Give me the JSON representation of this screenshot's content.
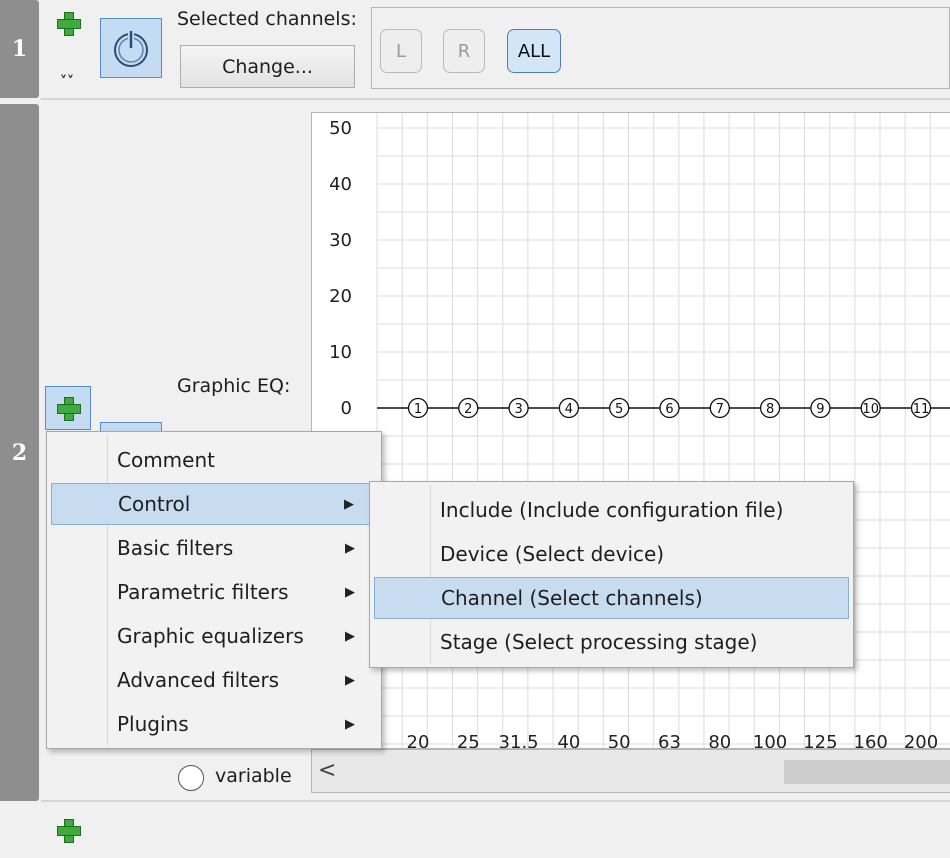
{
  "rows": [
    "1",
    "2"
  ],
  "row1": {
    "selected_channels_label": "Selected channels:",
    "change_button": "Change...",
    "channels": {
      "left": "L",
      "right": "R",
      "all": "ALL"
    }
  },
  "row2": {
    "graphic_eq_label": "Graphic EQ:",
    "variable_label": "variable",
    "scroll_left": "<"
  },
  "chart_data": {
    "type": "line",
    "y_ticks": [
      "50",
      "40",
      "30",
      "20",
      "10",
      "0"
    ],
    "ylim": [
      0,
      50
    ],
    "x_labels": [
      "20",
      "25",
      "31.5",
      "40",
      "50",
      "63",
      "80",
      "100",
      "125",
      "160",
      "200"
    ],
    "x": [
      20,
      25,
      31.5,
      40,
      50,
      63,
      80,
      100,
      125,
      160,
      200
    ],
    "values": [
      0,
      0,
      0,
      0,
      0,
      0,
      0,
      0,
      0,
      0,
      0
    ],
    "point_labels": [
      "1",
      "2",
      "3",
      "4",
      "5",
      "6",
      "7",
      "8",
      "9",
      "10",
      "11"
    ],
    "grid": true
  },
  "menu": {
    "items": [
      {
        "label": "Comment",
        "submenu": false
      },
      {
        "label": "Control",
        "submenu": true,
        "highlighted": true
      },
      {
        "label": "Basic filters",
        "submenu": true
      },
      {
        "label": "Parametric filters",
        "submenu": true
      },
      {
        "label": "Graphic equalizers",
        "submenu": true
      },
      {
        "label": "Advanced filters",
        "submenu": true
      },
      {
        "label": "Plugins",
        "submenu": true
      }
    ],
    "submenu": [
      {
        "label": "Include (Include configuration file)"
      },
      {
        "label": "Device (Select device)"
      },
      {
        "label": "Channel (Select channels)",
        "highlighted": true
      },
      {
        "label": "Stage (Select processing stage)"
      }
    ]
  },
  "icons": {
    "add": "plus-icon",
    "power": "power-icon",
    "collapse": "double-chevron-down-icon",
    "submenu_arrow": "triangle-right-icon"
  },
  "colors": {
    "selection": "#c8dcf0",
    "add_green": "#3faa3f",
    "row_number_bg": "#8e8e8e"
  }
}
